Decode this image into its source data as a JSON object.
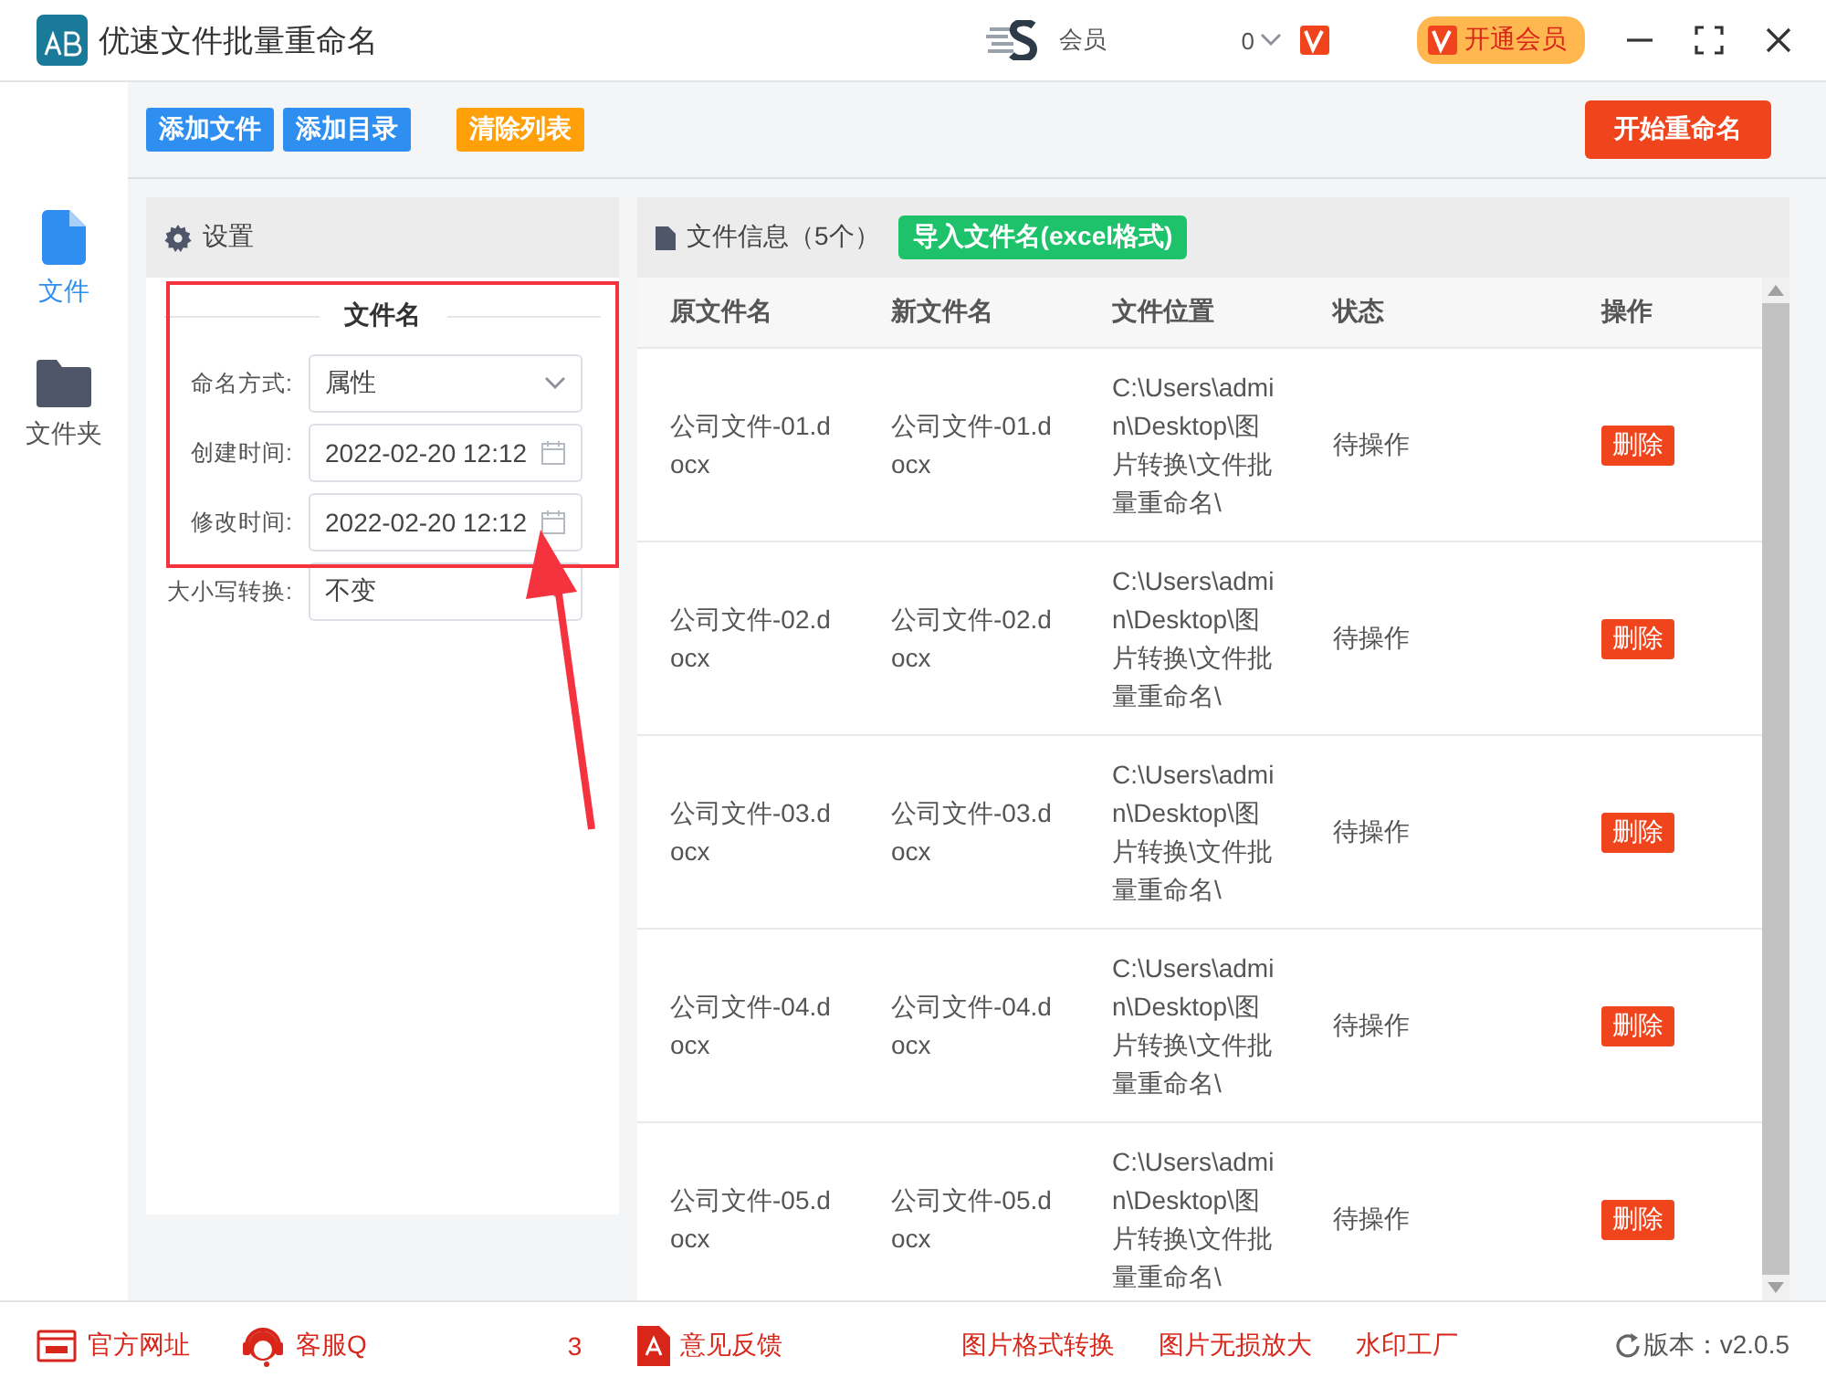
{
  "window": {
    "title": "优速文件批量重命名"
  },
  "header": {
    "member_label": "会员",
    "count": "0",
    "vip_button": "开通会员"
  },
  "toolbar": {
    "buttons": [
      {
        "label": "添加文件",
        "kind": "blue"
      },
      {
        "label": "添加目录",
        "kind": "blue"
      },
      {
        "label": "清除列表",
        "kind": "orange"
      }
    ],
    "start_button": "开始重命名"
  },
  "sidebar": {
    "items": [
      {
        "label": "文件",
        "kind": "file",
        "selected": true
      },
      {
        "label": "文件夹",
        "kind": "folder",
        "selected": false
      }
    ]
  },
  "settings": {
    "title": "设置",
    "section": "文件名",
    "fields": [
      {
        "label": "命名方式:",
        "value": "属性",
        "kind": "select"
      },
      {
        "label": "创建时间:",
        "value": "2022-02-20 12:12",
        "kind": "date"
      },
      {
        "label": "修改时间:",
        "value": "2022-02-20 12:12",
        "kind": "date"
      },
      {
        "label": "大小写转换:",
        "value": "不变",
        "kind": "select"
      }
    ]
  },
  "files": {
    "title": "文件信息（5个）",
    "import_button": "导入文件名(excel格式)",
    "table": {
      "columns": [
        "原文件名",
        "新文件名",
        "文件位置",
        "状态",
        "操作"
      ],
      "rows": [
        {
          "original": "公司文件-01.docx",
          "new": "公司文件-01.docx",
          "location": "C:\\Users\\admin\\Desktop\\图片转换\\文件批量重命名\\",
          "status": "待操作",
          "action": "删除"
        },
        {
          "original": "公司文件-02.docx",
          "new": "公司文件-02.docx",
          "location": "C:\\Users\\admin\\Desktop\\图片转换\\文件批量重命名\\",
          "status": "待操作",
          "action": "删除"
        },
        {
          "original": "公司文件-03.docx",
          "new": "公司文件-03.docx",
          "location": "C:\\Users\\admin\\Desktop\\图片转换\\文件批量重命名\\",
          "status": "待操作",
          "action": "删除"
        },
        {
          "original": "公司文件-04.docx",
          "new": "公司文件-04.docx",
          "location": "C:\\Users\\admin\\Desktop\\图片转换\\文件批量重命名\\",
          "status": "待操作",
          "action": "删除"
        },
        {
          "original": "公司文件-05.docx",
          "new": "公司文件-05.docx",
          "location": "C:\\Users\\admin\\Desktop\\图片转换\\文件批量重命名\\",
          "status": "待操作",
          "action": "删除"
        }
      ]
    }
  },
  "footer": {
    "links": [
      {
        "label": "官方网址",
        "kind": "web"
      },
      {
        "label": "客服Q",
        "kind": "support"
      },
      {
        "label": "意见反馈",
        "kind": "feedback"
      }
    ],
    "fragment": "3",
    "tools": [
      "图片格式转换",
      "图片无损放大",
      "水印工厂"
    ],
    "version": "版本：v2.0.5"
  }
}
